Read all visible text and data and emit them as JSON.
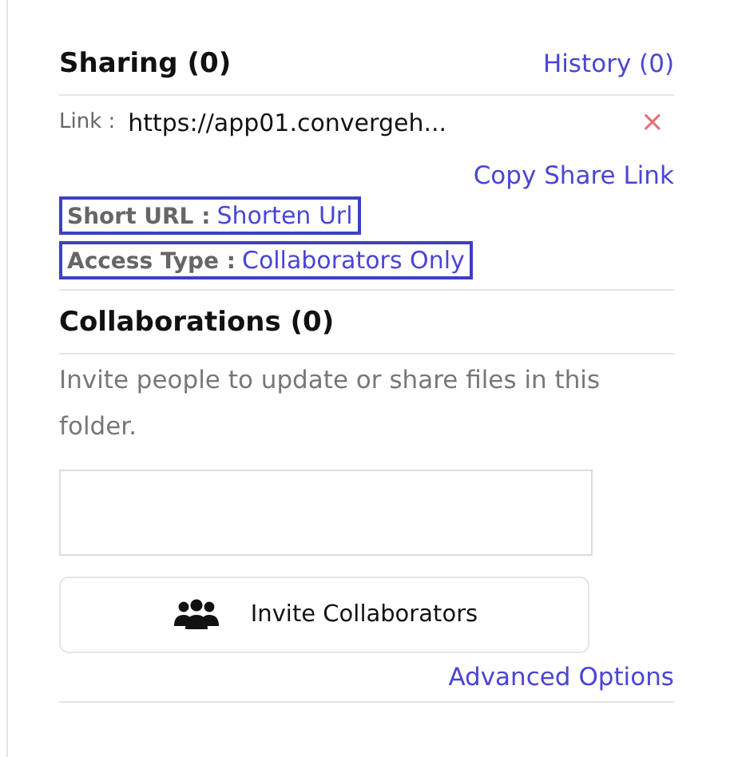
{
  "sharing": {
    "title": "Sharing (0)",
    "history_link": "History (0)",
    "link_label": "Link :",
    "link_value": "https://app01.convergeh...",
    "remove": "×",
    "copy_link": "Copy Share Link",
    "short_url": {
      "label": "Short URL :",
      "value": "Shorten Url"
    },
    "access_type": {
      "label": "Access Type :",
      "value": "Collaborators Only"
    }
  },
  "collaborations": {
    "title": "Collaborations (0)",
    "description": "Invite people to update or share files in this folder.",
    "invite_button": "Invite Collaborators",
    "advanced_link": "Advanced Options"
  }
}
